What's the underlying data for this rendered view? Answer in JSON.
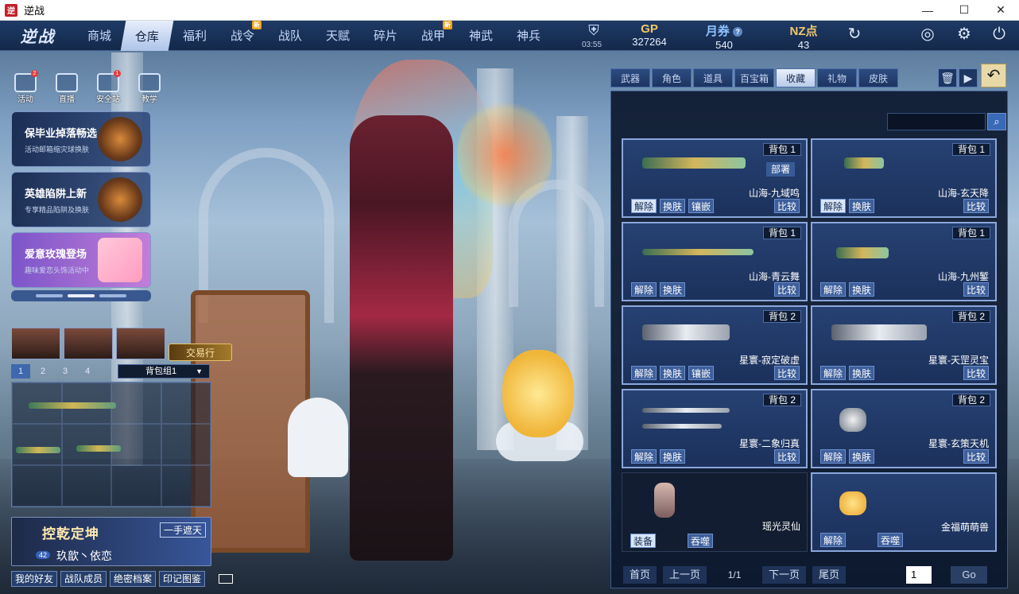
{
  "window": {
    "title": "逆战",
    "app_icon": "逆",
    "minimize": "—",
    "maximize": "☐",
    "close": "✕"
  },
  "nav": {
    "logo": "逆战",
    "tabs": [
      {
        "label": "商城",
        "badge": ""
      },
      {
        "label": "仓库",
        "badge": "",
        "active": true
      },
      {
        "label": "福利",
        "badge": ""
      },
      {
        "label": "战令",
        "badge": "新"
      },
      {
        "label": "战队",
        "badge": ""
      },
      {
        "label": "天赋",
        "badge": ""
      },
      {
        "label": "碎片",
        "badge": ""
      },
      {
        "label": "战甲",
        "badge": "新"
      },
      {
        "label": "神武",
        "badge": ""
      },
      {
        "label": "神兵",
        "badge": ""
      }
    ],
    "timer": "03:55",
    "gp_label": "GP",
    "gp_value": "327264",
    "coupon_label": "月券",
    "coupon_value": "540",
    "nz_label": "NZ点",
    "nz_value": "43",
    "help": "?"
  },
  "shortcuts": [
    {
      "label": "活动",
      "badge": "2"
    },
    {
      "label": "直播",
      "badge": ""
    },
    {
      "label": "安全站",
      "badge": "1"
    },
    {
      "label": "教学",
      "badge": ""
    }
  ],
  "promos": [
    {
      "title": "保毕业掉落畅选",
      "subtitle": "活动邮箱缩灾球换肤"
    },
    {
      "title": "英雄陷阱上新",
      "subtitle": "专享精品陷阱及换肤"
    },
    {
      "title": "爱意玫瑰登场",
      "subtitle": "趣味爱恋头饰活动中"
    }
  ],
  "left": {
    "trade_label": "交易行",
    "num_tabs": [
      "1",
      "2",
      "3",
      "4"
    ],
    "bag_group": "背包组1",
    "rank_title": "控乾定坤",
    "rank_side": "一手遮天",
    "level": "42",
    "nickname": "玖歆丶依恋",
    "bottom_buttons": [
      "我的好友",
      "战队成员",
      "绝密档案",
      "印记图鉴"
    ]
  },
  "panel": {
    "tabs": [
      "武器",
      "角色",
      "道具",
      "百宝箱",
      "收藏",
      "礼物",
      "皮肤"
    ],
    "active_tab": "收藏",
    "items": [
      {
        "bag": "背包 1",
        "name": "山海-九域鸣",
        "deploy": "部署",
        "actions": [
          "解除",
          "换肤",
          "镶嵌"
        ],
        "compare": "比较"
      },
      {
        "bag": "背包 1",
        "name": "山海-玄天降",
        "deploy": "",
        "actions": [
          "解除",
          "换肤"
        ],
        "compare": "比较"
      },
      {
        "bag": "背包 1",
        "name": "山海-青云舞",
        "deploy": "",
        "actions": [
          "解除",
          "换肤"
        ],
        "compare": "比较"
      },
      {
        "bag": "背包 1",
        "name": "山海-九州錾",
        "deploy": "",
        "actions": [
          "解除",
          "换肤"
        ],
        "compare": "比较"
      },
      {
        "bag": "背包 2",
        "name": "星寰-寂定破虚",
        "deploy": "",
        "actions": [
          "解除",
          "换肤",
          "镶嵌"
        ],
        "compare": "比较"
      },
      {
        "bag": "背包 2",
        "name": "星寰-天罡灵宝",
        "deploy": "",
        "actions": [
          "解除",
          "换肤"
        ],
        "compare": "比较"
      },
      {
        "bag": "背包 2",
        "name": "星寰-二象归真",
        "deploy": "",
        "actions": [
          "解除",
          "换肤"
        ],
        "compare": "比较"
      },
      {
        "bag": "背包 2",
        "name": "星寰-玄策天机",
        "deploy": "",
        "actions": [
          "解除",
          "换肤"
        ],
        "compare": "比较"
      },
      {
        "bag": "",
        "name": "瑶光灵仙",
        "deploy": "",
        "actions": [
          "装备",
          "吞噬"
        ],
        "compare": ""
      },
      {
        "bag": "",
        "name": "金福萌萌兽",
        "deploy": "",
        "actions": [
          "解除",
          "吞噬"
        ],
        "compare": ""
      }
    ],
    "pager": {
      "first": "首页",
      "prev": "上一页",
      "info": "1/1",
      "next": "下一页",
      "last": "尾页",
      "page_input": "1",
      "go": "Go"
    }
  }
}
